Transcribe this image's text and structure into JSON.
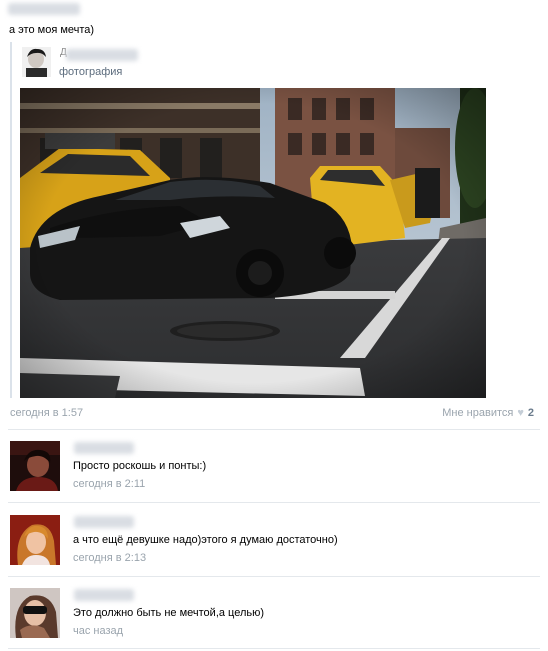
{
  "post": {
    "text": "а это моя мечта)",
    "time": "сегодня в 1:57",
    "likes_label": "Мне нравится",
    "likes_count": "2"
  },
  "repost": {
    "name_initial": "Д",
    "subtitle": "фотография"
  },
  "comments": [
    {
      "text": "Просто роскошь и понты:)",
      "time": "сегодня в 2:11"
    },
    {
      "text": "а что ещё девушке надо)этого я думаю достаточно)",
      "time": "сегодня в 2:13"
    },
    {
      "text": "Это должно быть не мечтой,а целью)",
      "time": "час назад"
    }
  ],
  "colors": {
    "link": "#5c6c7d",
    "meta": "#9aa4ad",
    "divider": "#e4e8ec"
  }
}
